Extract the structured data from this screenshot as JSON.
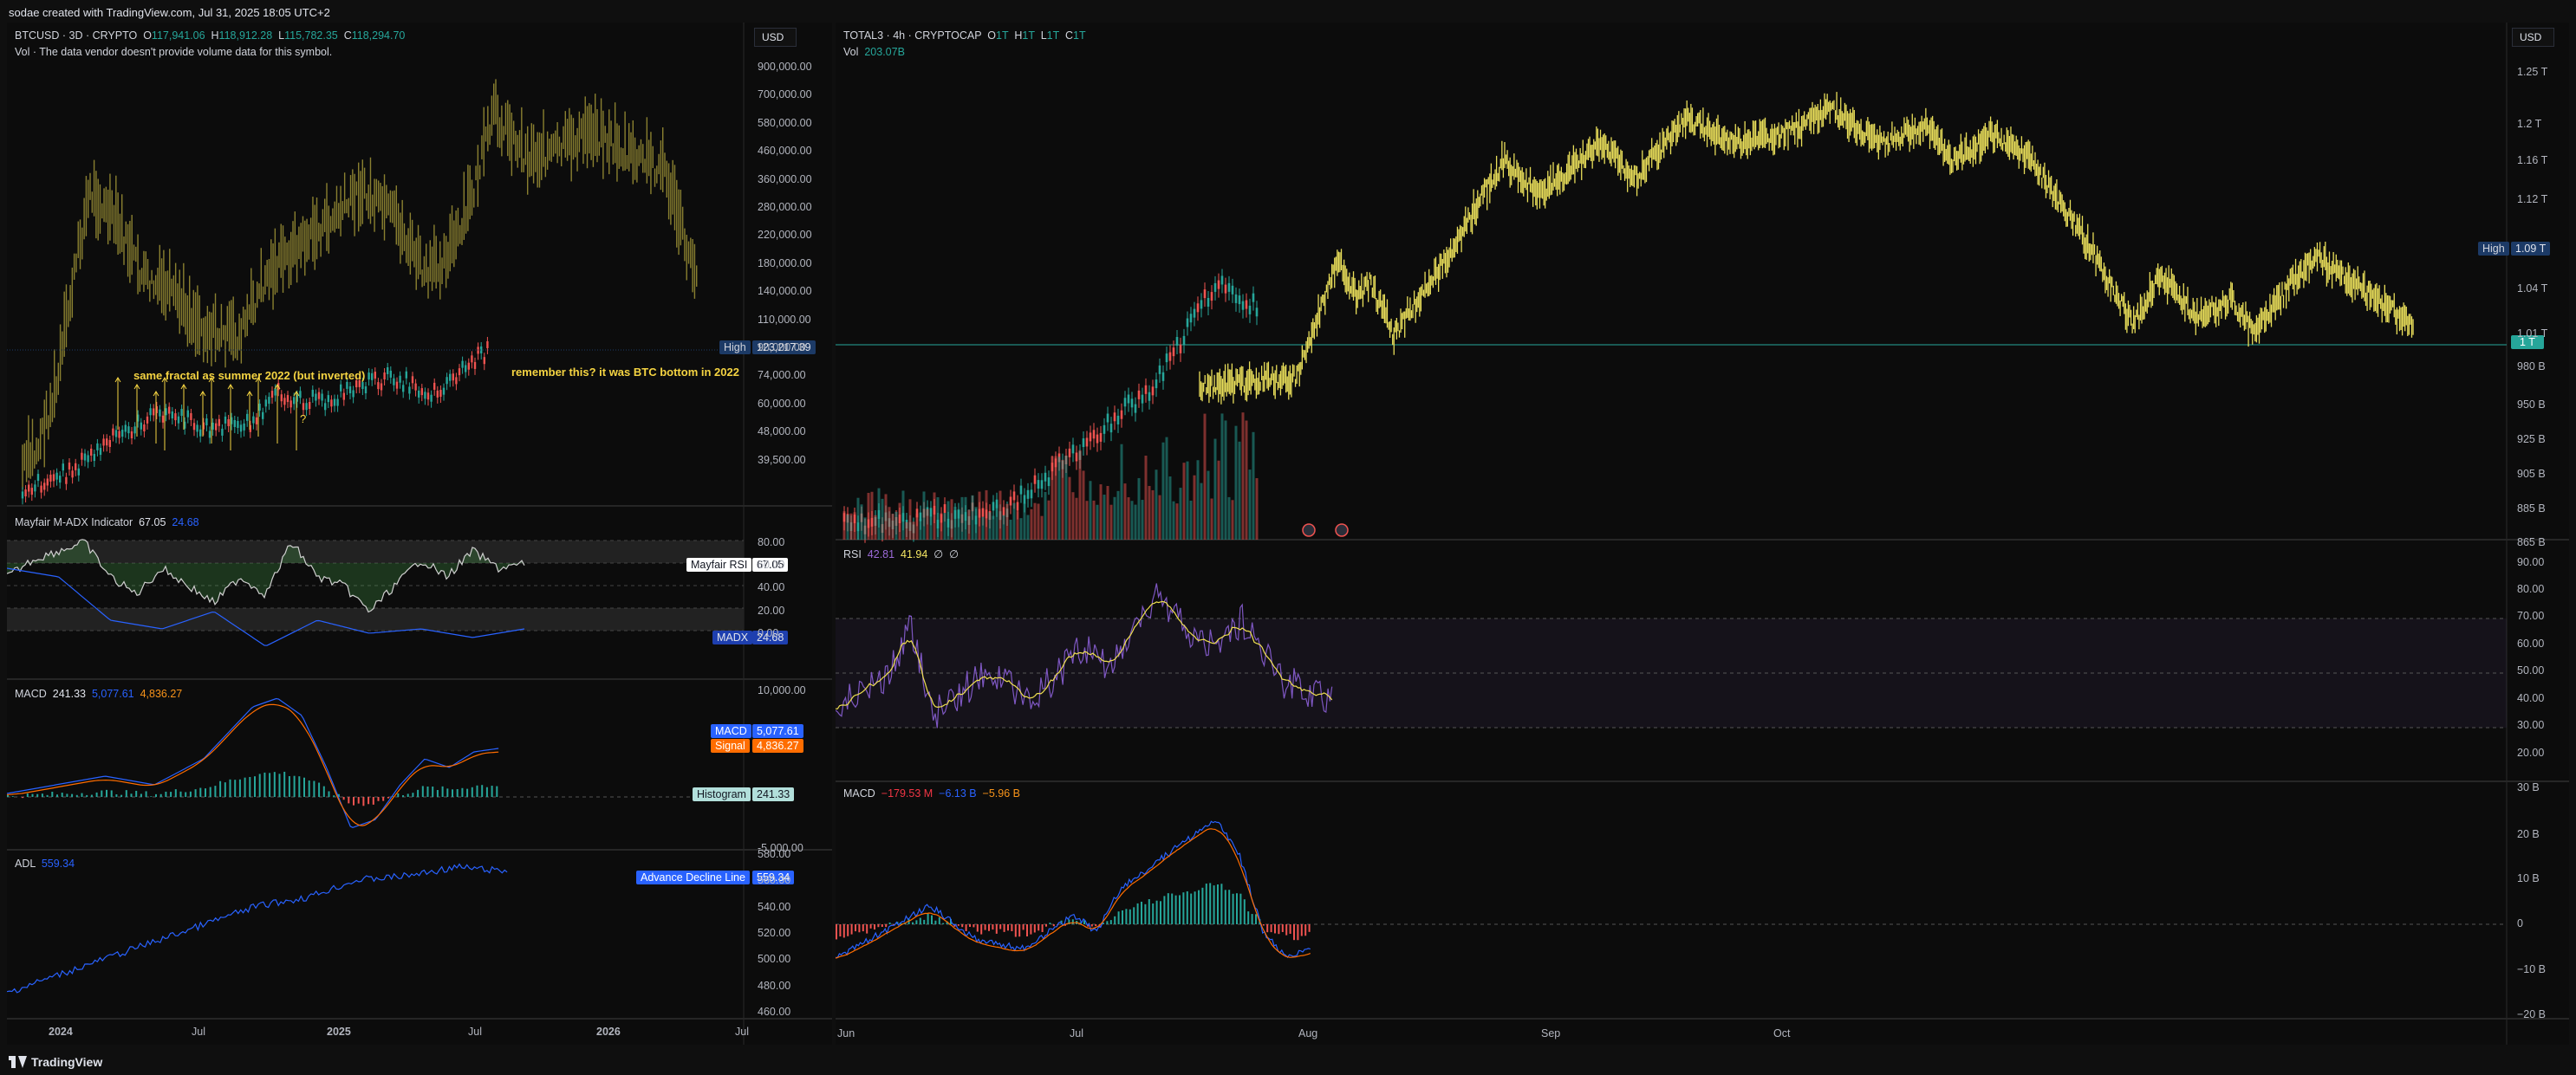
{
  "header": {
    "title": "sodae created with TradingView.com, Jul 31, 2025 18:05 UTC+2"
  },
  "footer": {
    "brand": "TradingView"
  },
  "left_chart": {
    "symbol": "BTCUSD · 3D · CRYPTO",
    "ohlc": {
      "o_label": "O",
      "o": "117,941.06",
      "h_label": "H",
      "h": "118,912.28",
      "l_label": "L",
      "l": "115,782.35",
      "c_label": "C",
      "c": "118,294.70"
    },
    "vol_note": "Vol · The data vendor doesn't provide volume data for this symbol.",
    "currency": "USD",
    "price_axis": [
      "900,000.00",
      "700,000.00",
      "580,000.00",
      "460,000.00",
      "360,000.00",
      "280,000.00",
      "220,000.00",
      "180,000.00",
      "140,000.00",
      "110,000.00",
      "90,000.00",
      "74,000.00",
      "60,000.00",
      "48,000.00",
      "39,500.00"
    ],
    "high_label": "High",
    "high_value": "123,217.39",
    "annotation_1": "same fractal as summer 2022 (but inverted)",
    "annotation_2": "remember this? it was BTC bottom in 2022",
    "question_mark": "?",
    "time_axis": [
      "2024",
      "Jul",
      "2025",
      "Jul",
      "2026",
      "Jul"
    ],
    "adx_pane": {
      "name": "Mayfair M-ADX Indicator",
      "v1": "67.05",
      "v2": "24.68",
      "axis": [
        "80.00",
        "60.00",
        "40.00",
        "20.00",
        "0.00"
      ],
      "rsi_tag_label": "Mayfair RSI",
      "rsi_tag_value": "67.05",
      "madx_tag_label": "MADX",
      "madx_tag_value": "24.68"
    },
    "macd_pane": {
      "name": "MACD",
      "v1": "241.33",
      "v2": "5,077.61",
      "v3": "4,836.27",
      "axis": [
        "10,000.00",
        "-5,000.00"
      ],
      "macd_tag_label": "MACD",
      "macd_tag_value": "5,077.61",
      "signal_tag_label": "Signal",
      "signal_tag_value": "4,836.27",
      "hist_tag_label": "Histogram",
      "hist_tag_value": "241.33"
    },
    "adl_pane": {
      "name": "ADL",
      "v1": "559.34",
      "axis": [
        "580.00",
        "560.00",
        "540.00",
        "520.00",
        "500.00",
        "480.00",
        "460.00"
      ],
      "tag_label": "Advance Decline Line",
      "tag_value": "559.34"
    }
  },
  "right_chart": {
    "symbol": "TOTAL3 · 4h · CRYPTOCAP",
    "ohlc": {
      "o_label": "O",
      "o": "1T",
      "h_label": "H",
      "h": "1T",
      "l_label": "L",
      "l": "1T",
      "c_label": "C",
      "c": "1T"
    },
    "vol_label": "Vol",
    "vol_value": "203.07B",
    "currency": "USD",
    "price_axis": [
      "1.25 T",
      "1.2 T",
      "1.16 T",
      "1.12 T",
      "1.04 T",
      "1.01 T",
      "980 B",
      "950 B",
      "925 B",
      "905 B",
      "885 B",
      "865 B"
    ],
    "high_label": "High",
    "high_value": "1.09 T",
    "last_value": "1 T",
    "time_axis": [
      "Jun",
      "Jul",
      "Aug",
      "Sep",
      "Oct"
    ],
    "rsi_pane": {
      "name": "RSI",
      "v1": "42.81",
      "v2": "41.94",
      "v3": "∅",
      "v4": "∅",
      "axis": [
        "90.00",
        "80.00",
        "70.00",
        "60.00",
        "50.00",
        "40.00",
        "30.00",
        "20.00"
      ]
    },
    "macd_pane": {
      "name": "MACD",
      "v1": "−179.53 M",
      "v2": "−6.13 B",
      "v3": "−5.96 B",
      "axis": [
        "30 B",
        "20 B",
        "10 B",
        "0",
        "−10 B",
        "−20 B"
      ]
    }
  },
  "colors": {
    "up": "#26a69a",
    "down": "#ef5350",
    "btc_fractal": "#8a8030",
    "total3": "#e9de5a",
    "macd": "#2962ff",
    "signal": "#ff6d00",
    "rsi": "#7e57c2",
    "rsi_ma": "#f0e050",
    "adl": "#2962ff"
  }
}
